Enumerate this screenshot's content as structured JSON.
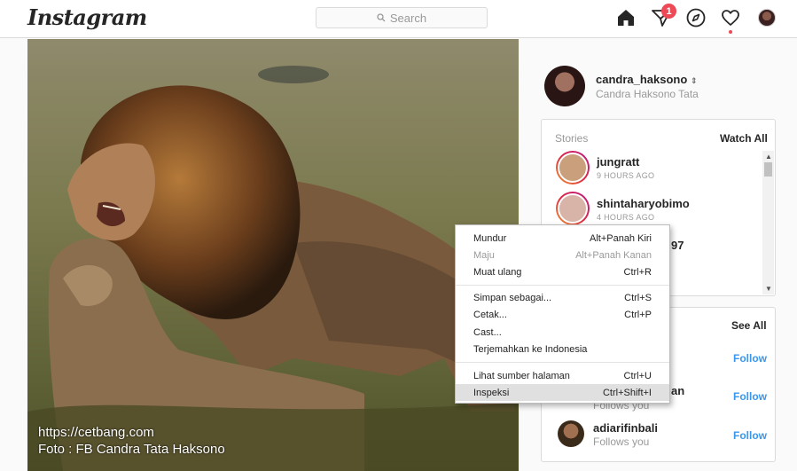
{
  "header": {
    "logo": "Instagram",
    "search_placeholder": "Search",
    "notification_count": "1"
  },
  "post": {
    "watermark_line1": "https://cetbang.com",
    "watermark_line2": "Foto : FB Candra Tata Haksono"
  },
  "profile": {
    "username": "candra_haksono",
    "full_name": "Candra Haksono Tata"
  },
  "stories": {
    "title": "Stories",
    "watch_all": "Watch All",
    "items": [
      {
        "username": "jungratt",
        "time": "9 HOURS AGO"
      },
      {
        "username": "shintaharyobimo",
        "time": "4 HOURS AGO"
      },
      {
        "username": "97",
        "time": ""
      }
    ]
  },
  "suggestions": {
    "see_all": "See All",
    "items": [
      {
        "username": "",
        "sub": "",
        "follow": "Follow"
      },
      {
        "username": "an",
        "sub": "Follows you",
        "follow": "Follow"
      },
      {
        "username": "adiarifinbali",
        "sub": "Follows you",
        "follow": "Follow"
      }
    ]
  },
  "context_menu": {
    "items": [
      {
        "label": "Mundur",
        "shortcut": "Alt+Panah Kiri",
        "disabled": false
      },
      {
        "label": "Maju",
        "shortcut": "Alt+Panah Kanan",
        "disabled": true
      },
      {
        "label": "Muat ulang",
        "shortcut": "Ctrl+R",
        "disabled": false
      },
      {
        "label": "Simpan sebagai...",
        "shortcut": "Ctrl+S",
        "disabled": false
      },
      {
        "label": "Cetak...",
        "shortcut": "Ctrl+P",
        "disabled": false
      },
      {
        "label": "Cast...",
        "shortcut": "",
        "disabled": false
      },
      {
        "label": "Terjemahkan ke Indonesia",
        "shortcut": "",
        "disabled": false
      },
      {
        "label": "Lihat sumber halaman",
        "shortcut": "Ctrl+U",
        "disabled": false
      },
      {
        "label": "Inspeksi",
        "shortcut": "Ctrl+Shift+I",
        "disabled": false
      }
    ]
  },
  "colors": {
    "accent_link": "#3897f0",
    "badge": "#ed4956",
    "annotation_arrow": "#d32f2f"
  }
}
